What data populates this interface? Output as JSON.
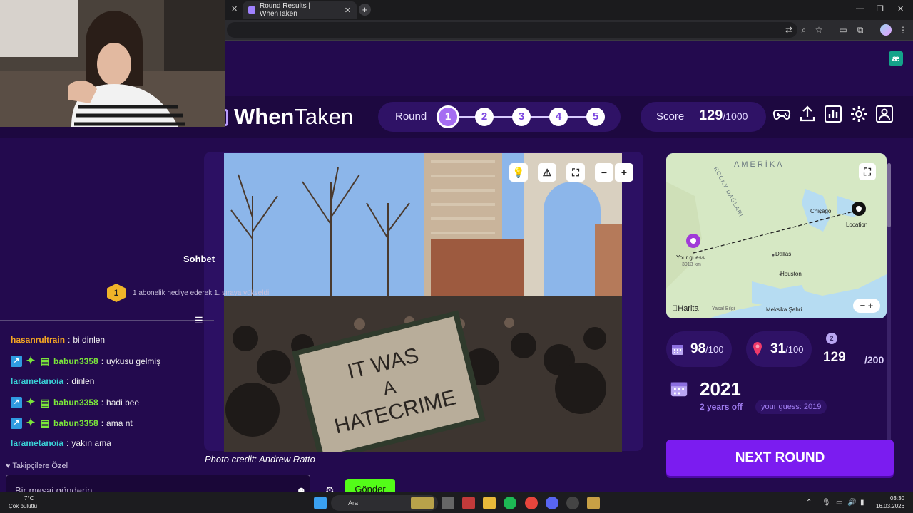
{
  "browser": {
    "active_tab_title": "Round Results | WhenTaken",
    "new_tab_icon": "plus-icon"
  },
  "header": {
    "logo_when": "When",
    "logo_taken": "Taken",
    "round_label": "Round",
    "rounds": [
      "1",
      "2",
      "3",
      "4",
      "5"
    ],
    "active_round": 1,
    "score_label": "Score",
    "score_value": "129",
    "score_max": "/1000",
    "icons": [
      "gamepad-icon",
      "share-icon",
      "stats-icon",
      "gear-icon",
      "profile-icon"
    ]
  },
  "photo": {
    "sign_text": "IT WAS A HATECRIME",
    "credit": "Photo credit: Andrew Ratto",
    "controls": [
      "lightbulb-icon",
      "warning-icon",
      "fullscreen-icon",
      "zoom-out-icon",
      "zoom-in-icon"
    ]
  },
  "map": {
    "labels": {
      "continent": "AMERİKA",
      "mountains": "ROCKY DAĞLARI",
      "chicago": "Chicago",
      "location": "Location",
      "dallas": "Dallas",
      "houston": "Houston",
      "mexico": "Meksika Şehri",
      "your_guess": "Your guess",
      "distance": "3913 km",
      "brand": "Harita",
      "legal": "Yasal Bilgi"
    }
  },
  "stats": {
    "year_points": "98",
    "year_points_max": "/100",
    "location_points": "31",
    "location_points_max": "/100",
    "total": "129",
    "total_max": "/200",
    "medal_number": "2",
    "year": "2021",
    "years_off": "2 years off",
    "your_guess": "your guess: 2019"
  },
  "next_button": "NEXT ROUND",
  "chat": {
    "title": "Sohbet",
    "sub_rank": "1",
    "sub_banner": "1 abonelik hediye ederek 1. sıraya yükseldi",
    "messages": [
      {
        "user": "hasanrultrain",
        "text": "bi dinlen",
        "color": "#f5a623",
        "badges": false
      },
      {
        "user": "babun3358",
        "text": "uykusu gelmiş",
        "color": "#7be63a",
        "badges": true
      },
      {
        "user": "larametanoia",
        "text": "dinlen",
        "color": "#3ad1d6",
        "badges": false
      },
      {
        "user": "babun3358",
        "text": "hadi bee",
        "color": "#7be63a",
        "badges": true
      },
      {
        "user": "babun3358",
        "text": "ama nt",
        "color": "#7be63a",
        "badges": true
      },
      {
        "user": "larametanoia",
        "text": "yakın ama",
        "color": "#3ad1d6",
        "badges": false
      }
    ],
    "followers_only": "Takipçilere Özel",
    "input_placeholder": "Bir mesaj gönderin",
    "send_label": "Gönder"
  },
  "taskbar": {
    "temperature": "7°C",
    "weather": "Çok bulutlu",
    "search_placeholder": "Ara",
    "time": "03:30",
    "date": "16.03.2026"
  },
  "colors": {
    "page_bg": "#230a4e",
    "card_bg": "#2f1266",
    "accent": "#7b1cf0",
    "send": "#53fc18"
  }
}
